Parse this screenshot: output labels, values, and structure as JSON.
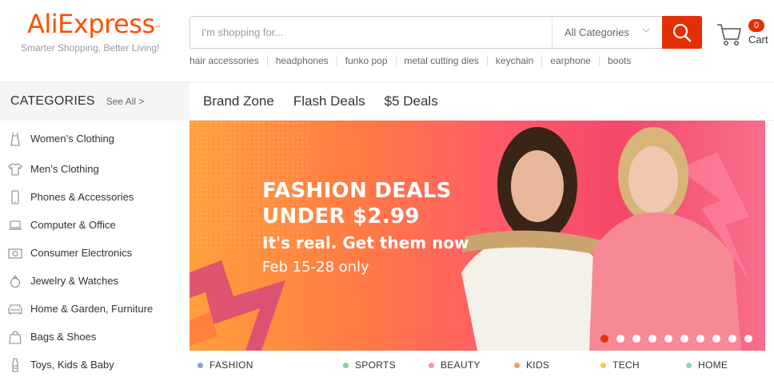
{
  "header": {
    "logo_text": "AliExpress",
    "logo_tm": "™",
    "tagline": "Smarter Shopping, Better Living!",
    "brand_color": "#ff4e00"
  },
  "search": {
    "placeholder": "I'm shopping for...",
    "value": "",
    "category_selected": "All Categories",
    "button_icon": "search-icon",
    "button_color": "#e62e04"
  },
  "cart": {
    "count": "0",
    "label": "Cart",
    "icon": "cart-icon"
  },
  "hot_words": [
    "hair accessories",
    "headphones",
    "funko pop",
    "metal cutting dies",
    "keychain",
    "earphone",
    "boots"
  ],
  "nav": {
    "categories_title": "CATEGORIES",
    "see_all": "See All >",
    "links": [
      "Brand Zone",
      "Flash Deals",
      "$5 Deals"
    ]
  },
  "categories": [
    {
      "label": "Women’s Clothing",
      "icon": "dress-icon"
    },
    {
      "label": "Men’s Clothing",
      "icon": "shirt-icon"
    },
    {
      "label": "Phones & Accessories",
      "icon": "phone-icon"
    },
    {
      "label": "Computer & Office",
      "icon": "laptop-icon"
    },
    {
      "label": "Consumer Electronics",
      "icon": "camera-icon"
    },
    {
      "label": "Jewelry & Watches",
      "icon": "ring-icon"
    },
    {
      "label": "Home & Garden, Furniture",
      "icon": "sofa-icon"
    },
    {
      "label": "Bags & Shoes",
      "icon": "bag-icon"
    },
    {
      "label": "Toys, Kids & Baby",
      "icon": "bottle-icon"
    }
  ],
  "banner": {
    "line1": "FASHION DEALS",
    "line2": "UNDER $2.99",
    "line3": "It's real. Get them now",
    "line4": "Feb 15-28 only",
    "slide_count": 10,
    "active_slide": 1
  },
  "tabs": [
    {
      "label": "FASHION",
      "color": "#8a9ce0"
    },
    {
      "label": "SPORTS",
      "color": "#7fd48a"
    },
    {
      "label": "BEAUTY",
      "color": "#f29a9a"
    },
    {
      "label": "KIDS",
      "color": "#e9a06e"
    },
    {
      "label": "TECH",
      "color": "#f2c94c"
    },
    {
      "label": "HOME",
      "color": "#8ed1d1"
    }
  ]
}
